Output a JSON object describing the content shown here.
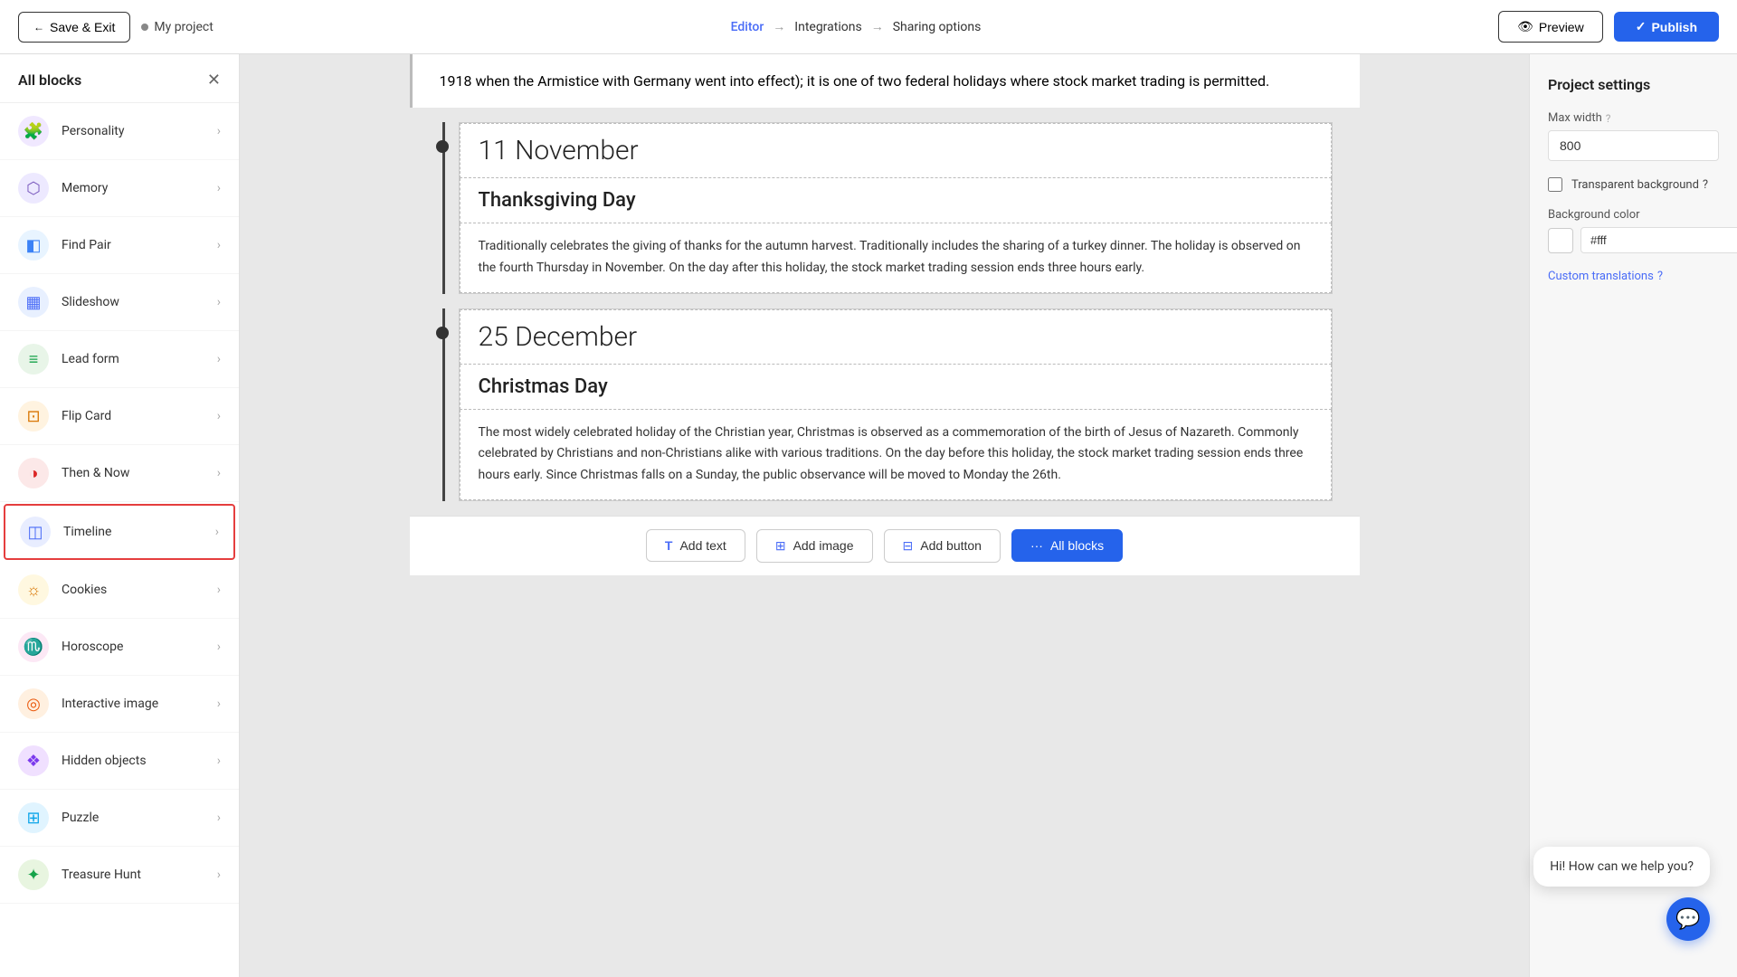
{
  "topNav": {
    "saveExit": "Save & Exit",
    "projectName": "My project",
    "steps": [
      {
        "label": "Editor",
        "active": true
      },
      {
        "label": "Integrations",
        "active": false
      },
      {
        "label": "Sharing options",
        "active": false
      }
    ],
    "previewLabel": "Preview",
    "publishLabel": "Publish"
  },
  "sidebar": {
    "title": "All blocks",
    "items": [
      {
        "id": "personality",
        "label": "Personality",
        "icon": "🧩",
        "colorClass": "icon-personality"
      },
      {
        "id": "memory",
        "label": "Memory",
        "icon": "⬡",
        "colorClass": "icon-memory"
      },
      {
        "id": "findpair",
        "label": "Find Pair",
        "icon": "◧",
        "colorClass": "icon-findpair"
      },
      {
        "id": "slideshow",
        "label": "Slideshow",
        "icon": "▦",
        "colorClass": "icon-slideshow"
      },
      {
        "id": "leadform",
        "label": "Lead form",
        "icon": "≡",
        "colorClass": "icon-leadform"
      },
      {
        "id": "flipcard",
        "label": "Flip Card",
        "icon": "⊡",
        "colorClass": "icon-flipcard"
      },
      {
        "id": "thennow",
        "label": "Then & Now",
        "icon": "◑",
        "colorClass": "icon-thennow"
      },
      {
        "id": "timeline",
        "label": "Timeline",
        "icon": "◫",
        "colorClass": "icon-timeline",
        "active": true
      },
      {
        "id": "cookies",
        "label": "Cookies",
        "icon": "☼",
        "colorClass": "icon-cookies"
      },
      {
        "id": "horoscope",
        "label": "Horoscope",
        "icon": "♏",
        "colorClass": "icon-horoscope"
      },
      {
        "id": "interactive",
        "label": "Interactive image",
        "icon": "◎",
        "colorClass": "icon-interactive"
      },
      {
        "id": "hidden",
        "label": "Hidden objects",
        "icon": "❖",
        "colorClass": "icon-hidden"
      },
      {
        "id": "puzzle",
        "label": "Puzzle",
        "icon": "⊞",
        "colorClass": "icon-puzzle"
      },
      {
        "id": "treasure",
        "label": "Treasure Hunt",
        "icon": "✦",
        "colorClass": "icon-treasure"
      }
    ]
  },
  "editor": {
    "topText": "1918 when the Armistice with Germany went into effect); it is one of two federal holidays where stock market trading is permitted.",
    "entries": [
      {
        "date": "11 November",
        "name": "Thanksgiving Day",
        "description": "Traditionally celebrates the giving of thanks for the autumn harvest. Traditionally includes the sharing of a turkey dinner. The holiday is observed on the fourth Thursday in November. On the day after this holiday, the stock market trading session ends three hours early."
      },
      {
        "date": "25 December",
        "name": "Christmas Day",
        "description": "The most widely celebrated holiday of the Christian year, Christmas is observed as a commemoration of the birth of Jesus of Nazareth. Commonly celebrated by Christians and non-Christians alike with various traditions. On the day before this holiday, the stock market trading session ends three hours early. Since Christmas falls on a Sunday, the public observance will be moved to Monday the 26th."
      }
    ],
    "toolbar": {
      "addText": "Add text",
      "addImage": "Add image",
      "addButton": "Add button",
      "allBlocks": "All blocks"
    }
  },
  "rightPanel": {
    "title": "Project settings",
    "maxWidthLabel": "Max width",
    "maxWidthValue": "800",
    "maxWidthHelp": "?",
    "transparentBgLabel": "Transparent background",
    "transparentBgHelp": "?",
    "bgColorLabel": "Background color",
    "bgColorValue": "#fff",
    "customTranslations": "Custom translations",
    "customTranslationsHelp": "?"
  },
  "chat": {
    "bubbleText": "Hi! How can we help you?"
  }
}
